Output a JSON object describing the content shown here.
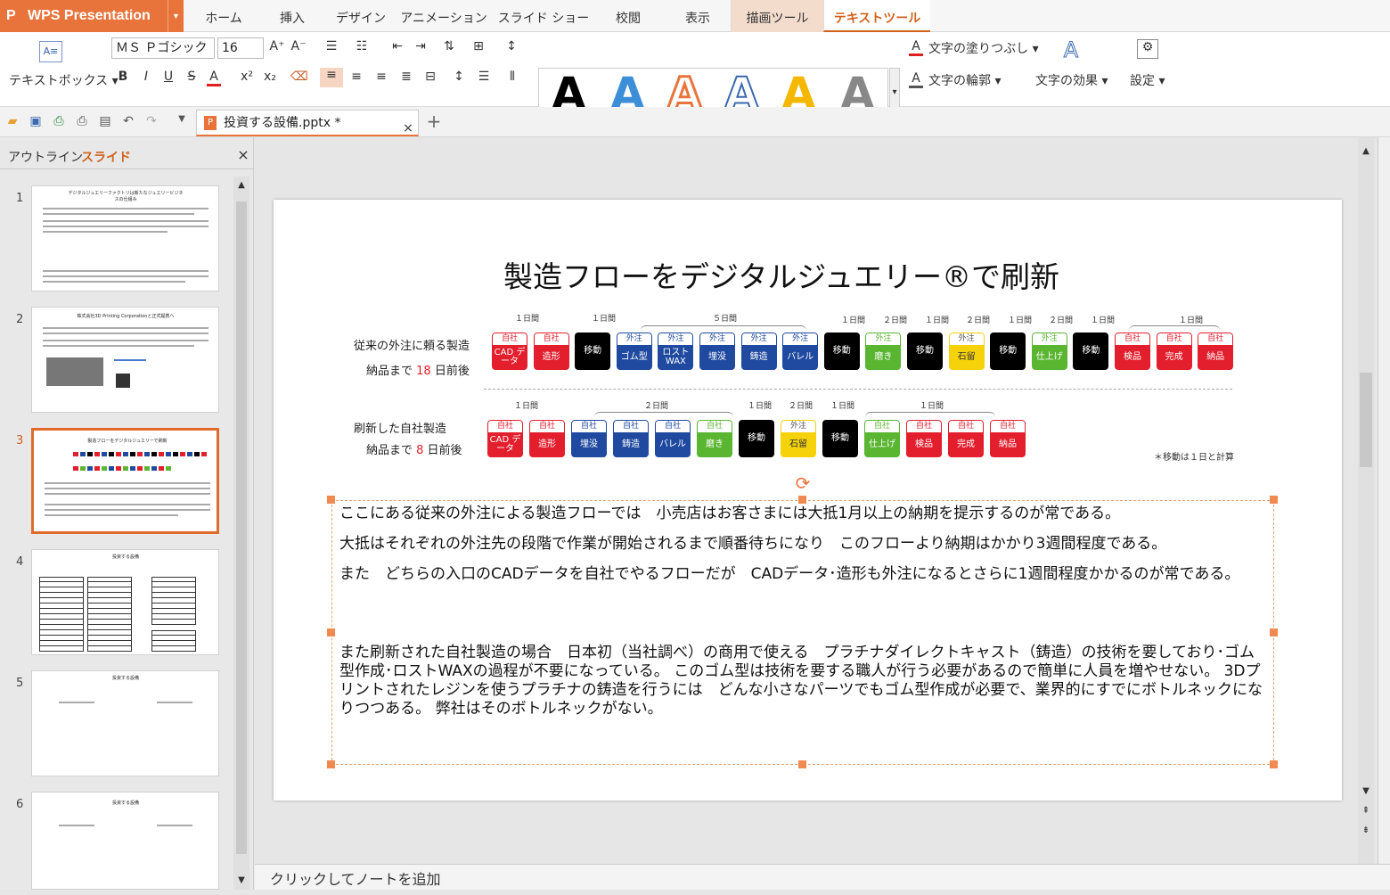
{
  "app": {
    "name": "WPS Presentation"
  },
  "tabs": [
    "ホーム",
    "挿入",
    "デザイン",
    "アニメーション",
    "スライド ショー",
    "校閲",
    "表示",
    "描画ツール",
    "テキストツール"
  ],
  "ribbon": {
    "textbox_label": "テキストボックス",
    "font_name": "ＭＳ Ｐゴシック",
    "font_size": "16",
    "fill_label": "文字の塗りつぶし",
    "outline_label": "文字の輪郭",
    "effect_label": "文字の効果",
    "settings_label": "設定",
    "bold": "B",
    "italic": "I",
    "underline": "U",
    "strike": "S",
    "color_a": "A",
    "sup": "x²",
    "sub": "x₂"
  },
  "doc_tab": {
    "name": "投資する設備.pptx *"
  },
  "left_panel": {
    "outline": "アウトライン",
    "slides": "スライド"
  },
  "thumbs": [
    {
      "num": "1",
      "title": "デジタルジュエリーファクトリは新たなジュエリービジネスの仕組み"
    },
    {
      "num": "2",
      "title": "株式会社3D Printing Corporationと正式提携へ"
    },
    {
      "num": "3",
      "title": "製造フローをデジタルジュエリーで刷新"
    },
    {
      "num": "4",
      "title": "投資する設備"
    },
    {
      "num": "5",
      "title": "投資する設備"
    },
    {
      "num": "6",
      "title": "投資する設備"
    }
  ],
  "slide": {
    "title": "製造フローをデジタルジュエリー®で刷新",
    "row1": {
      "label": "従来の外注に頼る製造",
      "lead_a": "納品まで ",
      "lead_num": "18",
      "lead_b": " 日前後"
    },
    "row2": {
      "label": "刷新した自社製造",
      "lead_a": "納品まで ",
      "lead_num": "8",
      "lead_b": " 日前後"
    },
    "note": "＊移動は１日と計算",
    "durations1": [
      "１日間",
      "１日間",
      "５日間",
      "１日間",
      "２日間",
      "１日間",
      "２日間",
      "１日間",
      "２日間",
      "１日間",
      "１日間"
    ],
    "durations2": [
      "１日間",
      "２日間",
      "１日間",
      "２日間",
      "１日間",
      "１日間"
    ],
    "blocks1": [
      {
        "top": "自社",
        "bot": "CAD データ",
        "c": "#e31e2d"
      },
      {
        "top": "自社",
        "bot": "造形",
        "c": "#e31e2d"
      },
      {
        "top": "",
        "bot": "移動",
        "c": "#000000"
      },
      {
        "top": "外注",
        "bot": "ゴム型",
        "c": "#1f4aa0"
      },
      {
        "top": "外注",
        "bot": "ロスト WAX",
        "c": "#1f4aa0"
      },
      {
        "top": "外注",
        "bot": "埋没",
        "c": "#1f4aa0"
      },
      {
        "top": "外注",
        "bot": "鋳造",
        "c": "#1f4aa0"
      },
      {
        "top": "外注",
        "bot": "バレル",
        "c": "#1f4aa0"
      },
      {
        "top": "",
        "bot": "移動",
        "c": "#000000"
      },
      {
        "top": "外注",
        "bot": "磨き",
        "c": "#5ab531"
      },
      {
        "top": "",
        "bot": "移動",
        "c": "#000000"
      },
      {
        "top": "外注",
        "bot": "石留",
        "c": "#f5d20a"
      },
      {
        "top": "",
        "bot": "移動",
        "c": "#000000"
      },
      {
        "top": "外注",
        "bot": "仕上げ",
        "c": "#5ab531"
      },
      {
        "top": "",
        "bot": "移動",
        "c": "#000000"
      },
      {
        "top": "自社",
        "bot": "検品",
        "c": "#e31e2d"
      },
      {
        "top": "自社",
        "bot": "完成",
        "c": "#e31e2d"
      },
      {
        "top": "自社",
        "bot": "納品",
        "c": "#e31e2d"
      }
    ],
    "blocks2": [
      {
        "top": "自社",
        "bot": "CAD データ",
        "c": "#e31e2d"
      },
      {
        "top": "自社",
        "bot": "造形",
        "c": "#e31e2d"
      },
      {
        "top": "自社",
        "bot": "埋没",
        "c": "#1f4aa0"
      },
      {
        "top": "自社",
        "bot": "鋳造",
        "c": "#1f4aa0"
      },
      {
        "top": "自社",
        "bot": "バレル",
        "c": "#1f4aa0"
      },
      {
        "top": "自社",
        "bot": "磨き",
        "c": "#5ab531"
      },
      {
        "top": "",
        "bot": "移動",
        "c": "#000000"
      },
      {
        "top": "外注",
        "bot": "石留",
        "c": "#f5d20a"
      },
      {
        "top": "",
        "bot": "移動",
        "c": "#000000"
      },
      {
        "top": "自社",
        "bot": "仕上げ",
        "c": "#5ab531"
      },
      {
        "top": "自社",
        "bot": "検品",
        "c": "#e31e2d"
      },
      {
        "top": "自社",
        "bot": "完成",
        "c": "#e31e2d"
      },
      {
        "top": "自社",
        "bot": "納品",
        "c": "#e31e2d"
      }
    ],
    "paras": [
      "ここにある従来の外注による製造フローでは　小売店はお客さまには大抵1月以上の納期を提示するのが常である。",
      "大抵はそれぞれの外注先の段階で作業が開始されるまで順番待ちになり　このフローより納期はかかり3週間程度である。",
      "また　どちらの入口のCADデータを自社でやるフローだが　CADデータ･造形も外注になるとさらに1週間程度かかるのが常である。",
      "また刷新された自社製造の場合　日本初（当社調べ）の商用で使える　プラチナダイレクトキャスト（鋳造）の技術を要しており･ゴム型作成･ロストWAXの過程が不要になっている。 このゴム型は技術を要する職人が行う必要があるので簡単に人員を増やせない。 3Dプリントされたレジンを使うプラチナの鋳造を行うには　どんな小さなパーツでもゴム型作成が必要で、業界的にすでにボトルネックになりつつある。 弊社はそのボトルネックがない。"
    ]
  },
  "notes": {
    "placeholder": "クリックしてノートを追加"
  }
}
